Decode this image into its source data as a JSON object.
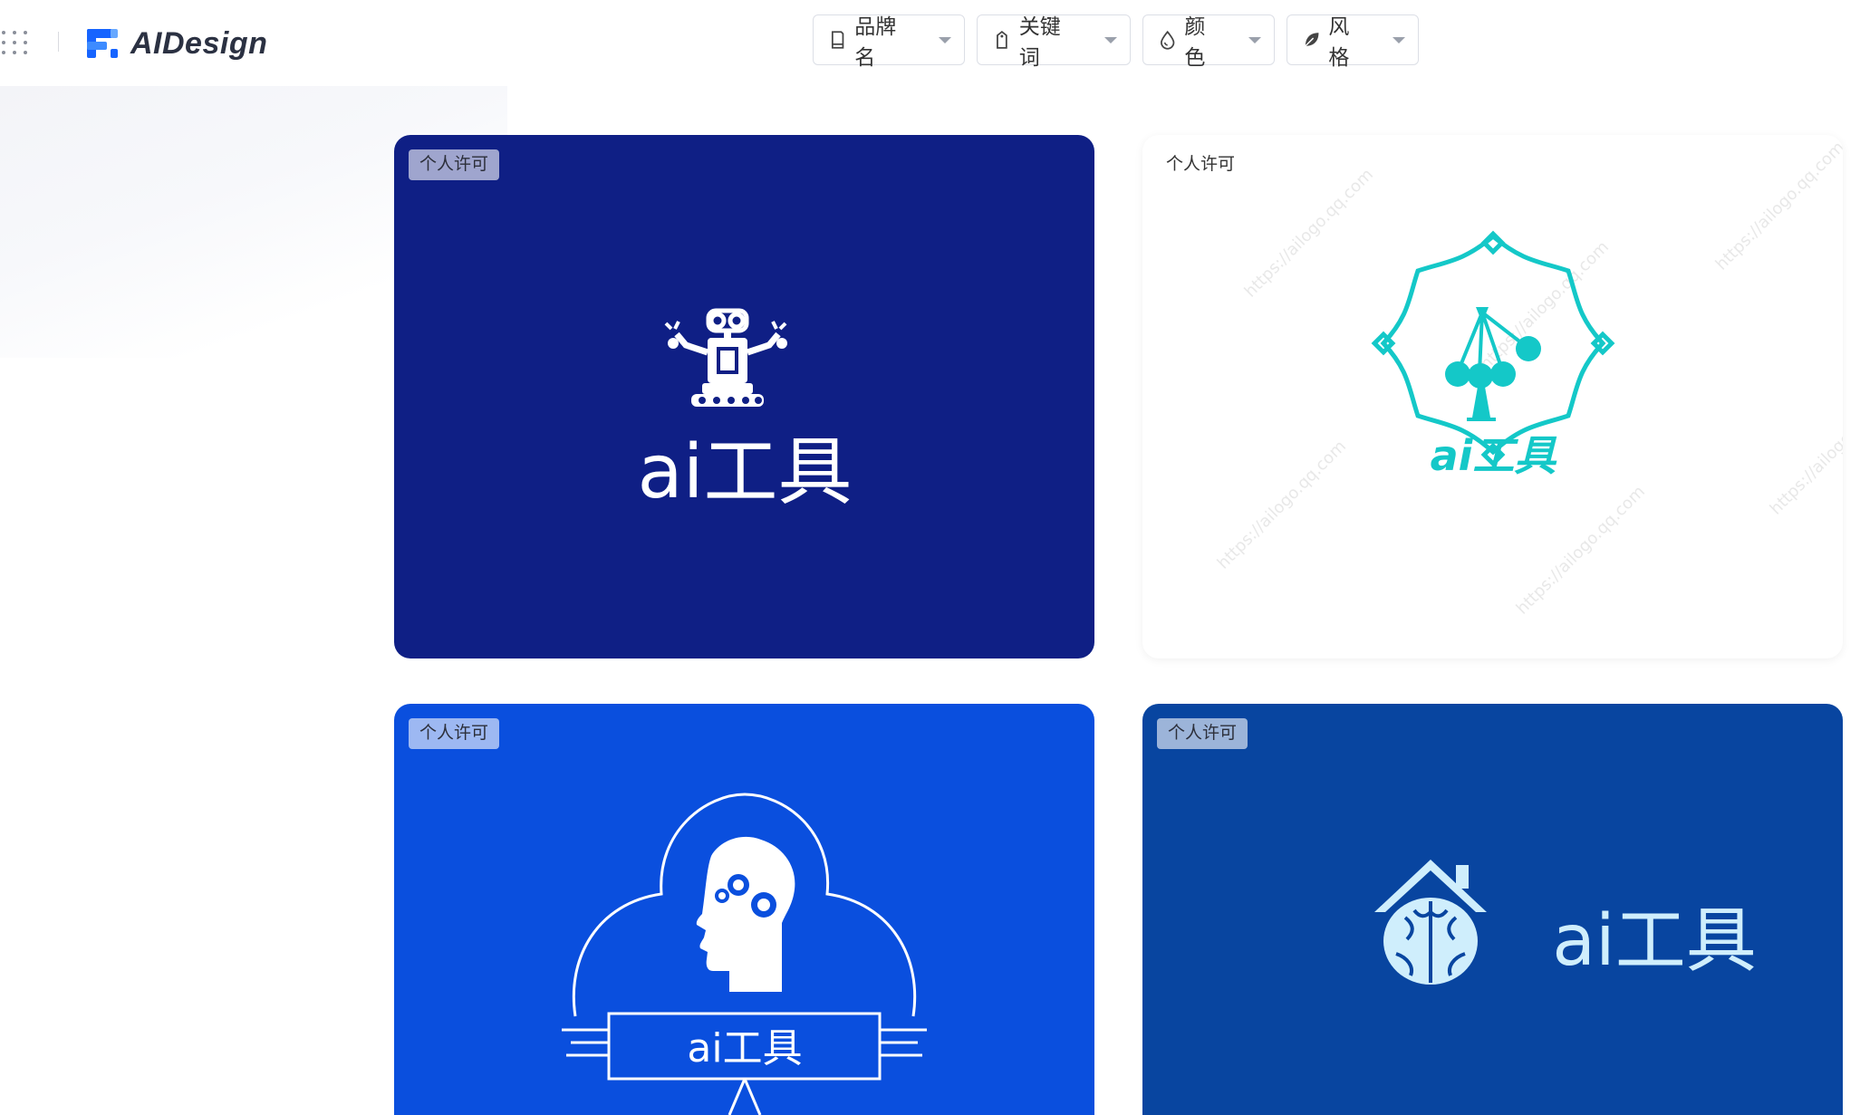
{
  "brand": {
    "name": "AIDesign",
    "accent": "#1664ff"
  },
  "filters": [
    {
      "label": "品牌名",
      "icon": "document-icon"
    },
    {
      "label": "关键词",
      "icon": "tag-icon"
    },
    {
      "label": "颜色",
      "icon": "droplet-icon"
    },
    {
      "label": "风格",
      "icon": "leaf-icon"
    }
  ],
  "cards": [
    {
      "badge": "个人许可",
      "logo_text": "ai工具",
      "bg": "#0f1f85",
      "fg": "#ffffff",
      "emblem": "robot-icon"
    },
    {
      "badge": "个人许可",
      "logo_text": "ai工具",
      "bg": "#ffffff",
      "fg": "#14c8c8",
      "emblem": "cherries-badge-icon",
      "watermark": "https://ailogo.qq.com"
    },
    {
      "badge": "个人许可",
      "logo_text": "ai工具",
      "bg": "#0a4fde",
      "fg": "#ffffff",
      "emblem": "brain-gears-cloud-icon"
    },
    {
      "badge": "个人许可",
      "logo_text": "ai工具",
      "bg": "#0845a0",
      "fg": "#cfeefc",
      "emblem": "brain-house-icon"
    }
  ]
}
